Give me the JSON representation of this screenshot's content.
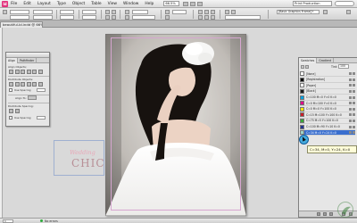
{
  "menubar": {
    "app_icon": "Id",
    "items": [
      "File",
      "Edit",
      "Layout",
      "Type",
      "Object",
      "Table",
      "View",
      "Window",
      "Help"
    ],
    "zoom": "66.5%",
    "workspace": "Print Production"
  },
  "control": {
    "style": "[Basic Graphics Frame]+"
  },
  "doc_tab": {
    "title": "beautiful-bl.indd @ 66%"
  },
  "align_panel": {
    "tabs": [
      "Align",
      "Pathfinder"
    ],
    "align_objects": "Align Objects:",
    "distribute_objects": "Distribute Objects:",
    "use_spacing": "Use Spacing",
    "align_to": "Align To:",
    "distribute_spacing": "Distribute Spacing:"
  },
  "swatches_panel": {
    "tabs": [
      "Swatches",
      "Gradient"
    ],
    "tint_label": "Tint:",
    "tint_value": "100",
    "rows": [
      {
        "name": "[None]",
        "color": "#ffffff"
      },
      {
        "name": "[Registration]",
        "color": "#000000"
      },
      {
        "name": "[Paper]",
        "color": "#ffffff"
      },
      {
        "name": "[Black]",
        "color": "#1a1a1a"
      },
      {
        "name": "C=100 M=0 Y=0 K=0",
        "color": "#00a0e0"
      },
      {
        "name": "C=0 M=100 Y=0 K=0",
        "color": "#e0008a"
      },
      {
        "name": "C=0 M=0 Y=100 K=0",
        "color": "#f5e600"
      },
      {
        "name": "C=15 M=100 Y=100 K=0",
        "color": "#c8202a"
      },
      {
        "name": "C=75 M=5 Y=100 K=0",
        "color": "#3aa53a"
      },
      {
        "name": "C=100 M=90 Y=10 K=0",
        "color": "#23358e"
      },
      {
        "name": "C=34 M=0 Y=24 K=0",
        "color": "#9fd4c8"
      }
    ],
    "selected_index": 10
  },
  "tooltip": {
    "text": "C=34, M=0, Y=24, K=0"
  },
  "canvas": {
    "chic_script": "Wedding",
    "chic_big": "CHIC"
  },
  "statusbar": {
    "page": "1",
    "errors": "No errors"
  },
  "colors": {
    "selection": "#3a6fcf",
    "guide_margin": "#d6a6d0",
    "guide_bleed": "#e07878"
  }
}
